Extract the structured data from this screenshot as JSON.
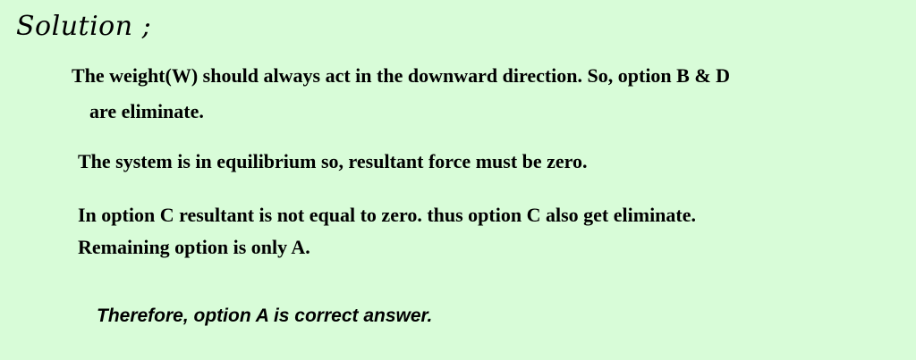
{
  "heading": "Solution ;",
  "paragraphs": [
    "The weight(W) should always act in the downward direction. So, option B & D",
    "are  eliminate.",
    "The system is in equilibrium so, resultant force must be zero.",
    "In option C resultant is not equal to zero. thus option C also get eliminate.",
    "Remaining option is only A."
  ],
  "conclusion": "Therefore, option A is correct answer.",
  "colors": {
    "background": "#d8fcd8",
    "text": "#000000"
  }
}
